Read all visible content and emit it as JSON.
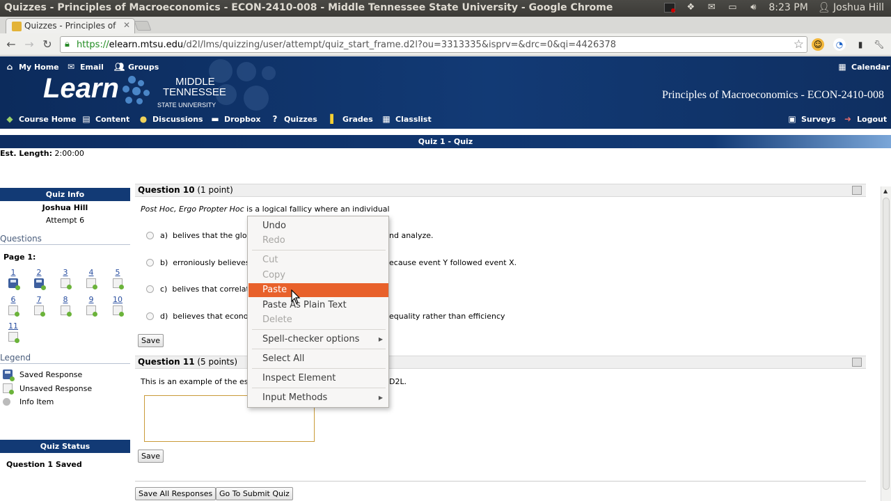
{
  "window": {
    "title": "Quizzes - Principles of Macroeconomics - ECON-2410-008 - Middle Tennessee State University - Google Chrome",
    "time": "8:23 PM",
    "user": "Joshua Hill"
  },
  "browser": {
    "tab_label": "Quizzes - Principles of Ma",
    "url_scheme": "https://",
    "url_domain": "elearn.mtsu.edu",
    "url_path": "/d2l/lms/quizzing/user/attempt/quiz_start_frame.d2l?ou=3313335&isprv=&drc=0&qi=4426378"
  },
  "header": {
    "top_nav": [
      "My Home",
      "Email",
      "Groups"
    ],
    "calendar": "Calendar",
    "logo_learn": "Learn",
    "logo_line1": "MIDDLE",
    "logo_line2": "TENNESSEE",
    "logo_line3": "STATE UNIVERSITY",
    "course_title": "Principles of Macroeconomics - ECON-2410-008",
    "course_nav": [
      "Course Home",
      "Content",
      "Discussions",
      "Dropbox",
      "Quizzes",
      "Grades",
      "Classlist"
    ],
    "right_nav": [
      "Surveys",
      "Logout"
    ]
  },
  "quiz_bar": "Quiz 1 - Quiz",
  "est_length": {
    "label": "Est. Length:",
    "value": "2:00:00"
  },
  "sidebar": {
    "quiz_info_title": "Quiz Info",
    "student": "Joshua Hill",
    "attempt": "Attempt 6",
    "questions_title": "Questions",
    "page_label": "Page 1:",
    "questions": [
      {
        "num": "1",
        "state": "saved"
      },
      {
        "num": "2",
        "state": "saved"
      },
      {
        "num": "3",
        "state": "unsaved"
      },
      {
        "num": "4",
        "state": "unsaved"
      },
      {
        "num": "5",
        "state": "unsaved"
      },
      {
        "num": "6",
        "state": "unsaved"
      },
      {
        "num": "7",
        "state": "unsaved"
      },
      {
        "num": "8",
        "state": "unsaved"
      },
      {
        "num": "9",
        "state": "unsaved"
      },
      {
        "num": "10",
        "state": "unsaved"
      },
      {
        "num": "11",
        "state": "unsaved"
      }
    ],
    "legend_title": "Legend",
    "legend": [
      "Saved Response",
      "Unsaved Response",
      "Info Item"
    ],
    "quiz_status_title": "Quiz Status",
    "status_text": "Question 1 Saved"
  },
  "q10": {
    "title": "Question 10",
    "points": "(1 point)",
    "prompt_italic": "Post Hoc, Ergo Propter Hoc",
    "prompt_rest": " is a logical fallicy where an individual",
    "options": [
      {
        "letter": "a)",
        "left": "belives that the glob",
        "right": "nd analyze."
      },
      {
        "letter": "b)",
        "left": "erroniously believes",
        "right": "ecause event Y followed event X."
      },
      {
        "letter": "c)",
        "left": "belives that correlat",
        "right": ""
      },
      {
        "letter": "d)",
        "left": "believes that econor",
        "right": "equality rather than efficiency"
      }
    ],
    "save": "Save"
  },
  "q11": {
    "title": "Question 11",
    "points": "(5 points)",
    "prompt_left": "This is an example of the ess",
    "prompt_right": "D2L.",
    "save": "Save"
  },
  "footer_buttons": {
    "save_all": "Save All Responses",
    "submit": "Go To Submit Quiz"
  },
  "context_menu": {
    "items": [
      {
        "label": "Undo",
        "enabled": true
      },
      {
        "label": "Redo",
        "enabled": false
      },
      {
        "label": "Cut",
        "enabled": false
      },
      {
        "label": "Copy",
        "enabled": false
      },
      {
        "label": "Paste",
        "enabled": true,
        "highlighted": true
      },
      {
        "label": "Paste As Plain Text",
        "enabled": true
      },
      {
        "label": "Delete",
        "enabled": false
      },
      {
        "label": "Spell-checker options",
        "enabled": true,
        "submenu": true
      },
      {
        "label": "Select All",
        "enabled": true
      },
      {
        "label": "Inspect Element",
        "enabled": true
      },
      {
        "label": "Input Methods",
        "enabled": true,
        "submenu": true
      }
    ]
  },
  "colors": {
    "highlight": "#e8612b",
    "header_blue": "#123a75"
  }
}
